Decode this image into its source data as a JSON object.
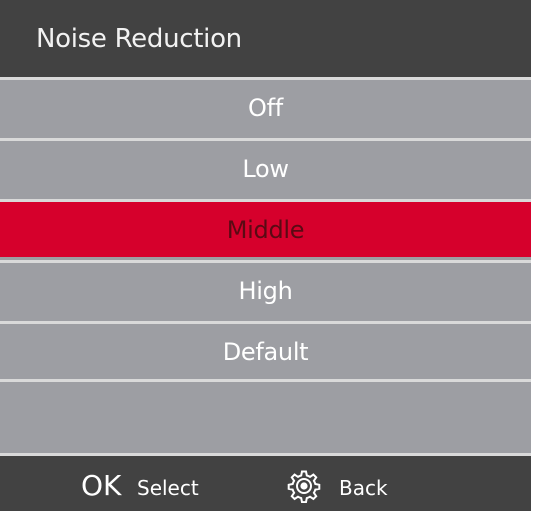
{
  "header": {
    "title": "Noise Reduction"
  },
  "menu": {
    "options": [
      "Off",
      "Low",
      "Middle",
      "High",
      "Default"
    ],
    "selected": "Middle"
  },
  "footer": {
    "ok_key": "OK",
    "ok_action": "Select",
    "back_icon": "gear-icon",
    "back_action": "Back"
  },
  "colors": {
    "header_bg": "#424242",
    "row_bg": "#9d9ea3",
    "selected_bg": "#d6002c",
    "divider": "#d9d9d9"
  }
}
